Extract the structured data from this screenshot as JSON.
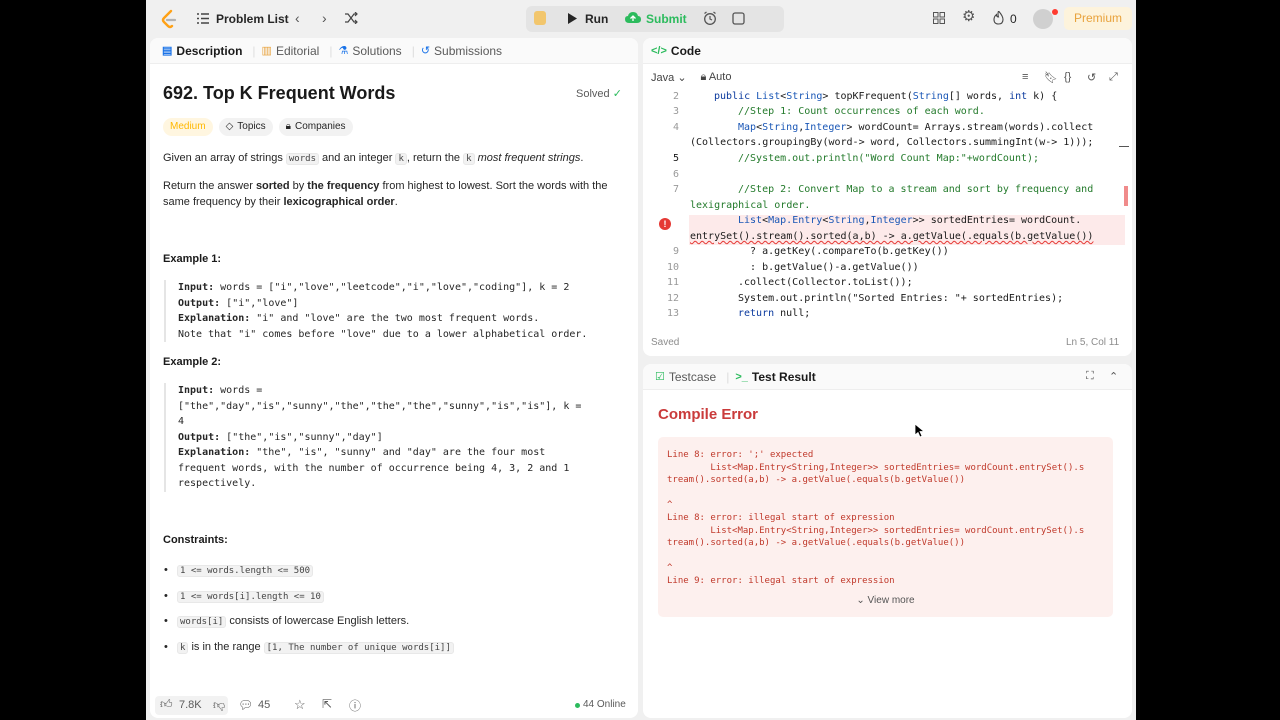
{
  "topbar": {
    "problem_list": "Problem List",
    "run": "Run",
    "submit": "Submit",
    "streak": "0",
    "premium": "Premium"
  },
  "left_tabs": [
    "Description",
    "Editorial",
    "Solutions",
    "Submissions"
  ],
  "problem": {
    "title": "692. Top K Frequent Words",
    "solved": "Solved",
    "difficulty": "Medium",
    "topics": "Topics",
    "companies": "Companies",
    "p1_a": "Given an array of strings ",
    "p1_code1": "words",
    "p1_b": " and an integer ",
    "p1_code2": "k",
    "p1_c": ", return the ",
    "p1_code3": "k",
    "p1_d": " most frequent strings",
    "p1_e": ".",
    "p2_a": "Return the answer ",
    "p2_b": "sorted",
    "p2_c": " by ",
    "p2_d": "the frequency",
    "p2_e": " from highest to lowest. Sort the words with the same frequency by their ",
    "p2_f": "lexicographical order",
    "p2_g": ".",
    "example1_title": "Example 1:",
    "ex1_input_label": "Input:",
    "ex1_input": " words = [\"i\",\"love\",\"leetcode\",\"i\",\"love\",\"coding\"], k = 2",
    "ex1_output_label": "Output:",
    "ex1_output": " [\"i\",\"love\"]",
    "ex1_expl_label": "Explanation:",
    "ex1_expl": " \"i\" and \"love\" are the two most frequent words.\nNote that \"i\" comes before \"love\" due to a lower alphabetical order.",
    "example2_title": "Example 2:",
    "ex2_input_label": "Input:",
    "ex2_input": " words =\n[\"the\",\"day\",\"is\",\"sunny\",\"the\",\"the\",\"the\",\"sunny\",\"is\",\"is\"], k =\n4",
    "ex2_output_label": "Output:",
    "ex2_output": " [\"the\",\"is\",\"sunny\",\"day\"]",
    "ex2_expl_label": "Explanation:",
    "ex2_expl": " \"the\", \"is\", \"sunny\" and \"day\" are the four most\nfrequent words, with the number of occurrence being 4, 3, 2 and 1\nrespectively.",
    "constraints_title": "Constraints:",
    "c1": "1 <= words.length <= 500",
    "c2": "1 <= words[i].length <= 10",
    "c3_code": "words[i]",
    "c3_text": " consists of lowercase English letters.",
    "c4_code": "k",
    "c4_text": " is in the range ",
    "c4_code2": "[1, The number of unique words[i]]"
  },
  "footer": {
    "likes": "7.8K",
    "comments": "45",
    "online": "44 Online"
  },
  "code": {
    "tab": "Code",
    "language": "Java",
    "mode": "Auto",
    "saved": "Saved",
    "position": "Ln 5, Col 11",
    "line_numbers": [
      "2",
      "3",
      "4",
      "",
      "5",
      "6",
      "7",
      "",
      "",
      "",
      "9",
      "10",
      "11",
      "12",
      "13"
    ]
  },
  "result": {
    "tab_testcase": "Testcase",
    "tab_result": "Test Result",
    "status": "Compile Error",
    "error_text": "Line 8: error: ';' expected\n        List<Map.Entry<String,Integer>> sortedEntries= wordCount.entrySet().s\ntream().sorted(a,b) -> a.getValue(.equals(b.getValue())\n\n^\nLine 8: error: illegal start of expression\n        List<Map.Entry<String,Integer>> sortedEntries= wordCount.entrySet().s\ntream().sorted(a,b) -> a.getValue(.equals(b.getValue())\n\n^\nLine 9: error: illegal start of expression",
    "view_more": "View more"
  }
}
